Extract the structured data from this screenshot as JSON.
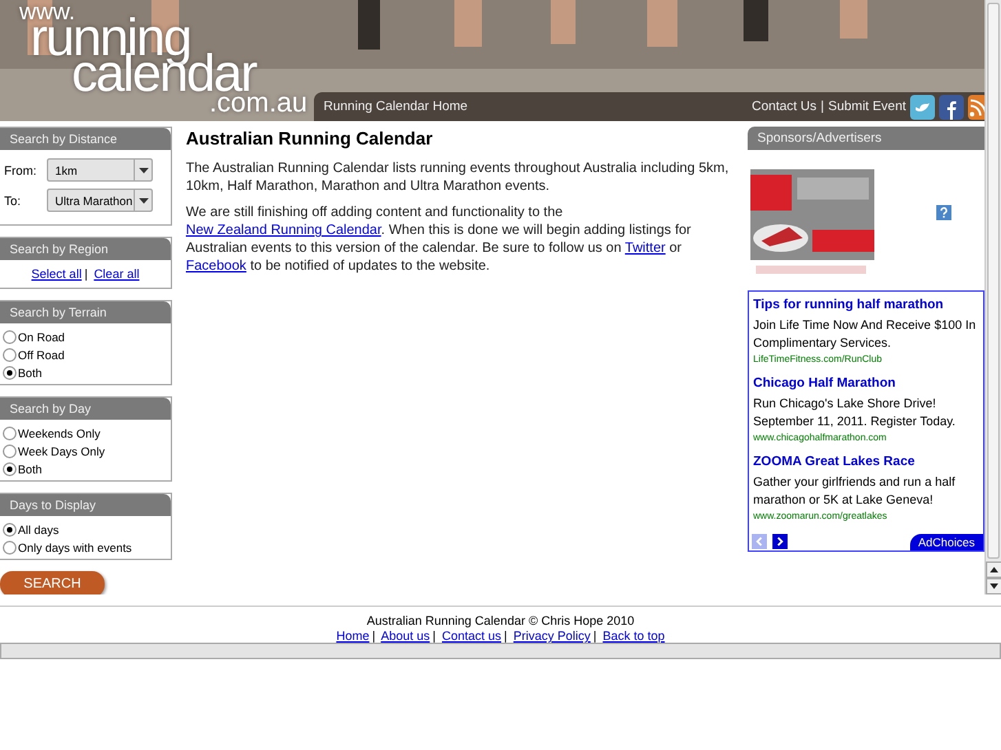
{
  "header": {
    "logo": {
      "prefix": "www.",
      "line1": "running",
      "line2": "calendar",
      "suffix": ".com.au"
    },
    "nav": {
      "home": "Running Calendar Home",
      "links": [
        "Contact Us",
        "Submit Event"
      ],
      "separator": "|"
    }
  },
  "sidebar": {
    "distance": {
      "title": "Search by Distance",
      "fields": [
        {
          "label": "From:",
          "value": "1km"
        },
        {
          "label": "To:",
          "value": "Ultra Marathon"
        }
      ]
    },
    "region": {
      "title": "Search by Region",
      "links": [
        "Select all",
        "Clear all"
      ],
      "separator": "|"
    },
    "radio_groups": [
      {
        "title": "Search by Terrain",
        "options": [
          {
            "label": "On Road",
            "selected": false
          },
          {
            "label": "Off Road",
            "selected": false
          },
          {
            "label": "Both",
            "selected": true
          }
        ]
      },
      {
        "title": "Search by Day",
        "options": [
          {
            "label": "Weekends Only",
            "selected": false
          },
          {
            "label": "Week Days Only",
            "selected": false
          },
          {
            "label": "Both",
            "selected": true
          }
        ]
      },
      {
        "title": "Days to Display",
        "options": [
          {
            "label": "All days",
            "selected": true
          },
          {
            "label": "Only days with events",
            "selected": false
          }
        ]
      }
    ],
    "search_button": "SEARCH"
  },
  "main": {
    "title": "Australian Running Calendar",
    "paragraphs": [
      [
        {
          "text": "The Australian Running Calendar lists running events throughout Australia including 5km, 10km, Half Marathon, Marathon and Ultra Marathon events."
        }
      ],
      [
        {
          "text": "We are still finishing off adding content and functionality to the "
        },
        {
          "link": "New Zealand Running Calendar"
        },
        {
          "text": ". When this is done we will begin adding listings for Australian events to this version of the calendar. Be sure to follow us on "
        },
        {
          "link": "Twitter"
        },
        {
          "text": " or "
        },
        {
          "link": "Facebook"
        },
        {
          "text": " to be notified of updates to the website."
        }
      ]
    ]
  },
  "sponsors": {
    "title": "Sponsors/Advertisers",
    "ads": [
      {
        "title": "Tips for running half marathon",
        "body": "Join Life Time Now And Receive $100 In Complimentary Services.",
        "url": "LifeTimeFitness.com/RunClub"
      },
      {
        "title": "Chicago Half Marathon",
        "body": "Run Chicago's Lake Shore Drive! September 11, 2011. Register Today.",
        "url": "www.chicagohalfmarathon.com"
      },
      {
        "title": "ZOOMA Great Lakes Race",
        "body": "Gather your girlfriends and run a half marathon or 5K at Lake Geneva!",
        "url": "www.zoomarun.com/greatlakes"
      }
    ],
    "adchoices": "AdChoices"
  },
  "footer": {
    "copyright": "Australian Running Calendar © Chris Hope 2010",
    "links": [
      "Home",
      "About us",
      "Contact us",
      "Privacy Policy",
      "Back to top"
    ],
    "separator": "|"
  }
}
